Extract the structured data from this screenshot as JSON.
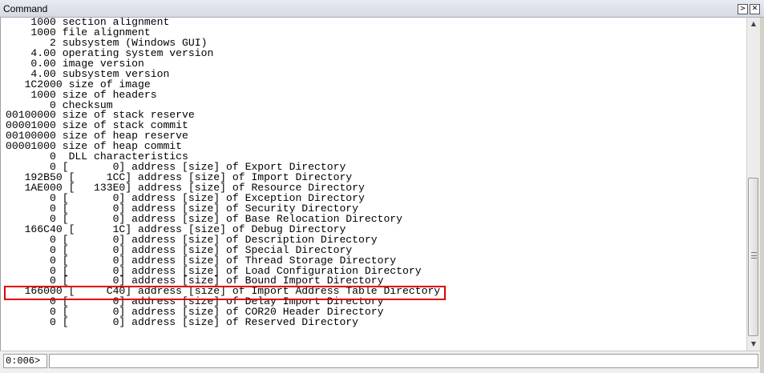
{
  "window": {
    "title": "Command",
    "command_icon": "command-window-icon",
    "close_icon": "close-icon"
  },
  "output": {
    "lines": [
      "    1000 section alignment",
      "    1000 file alignment",
      "       2 subsystem (Windows GUI)",
      "    4.00 operating system version",
      "    0.00 image version",
      "    4.00 subsystem version",
      "   1C2000 size of image",
      "    1000 size of headers",
      "       0 checksum",
      "00100000 size of stack reserve",
      "00001000 size of stack commit",
      "00100000 size of heap reserve",
      "00001000 size of heap commit",
      "       0  DLL characteristics",
      "       0 [       0] address [size] of Export Directory",
      "   192B50 [     1CC] address [size] of Import Directory",
      "   1AE000 [   133E0] address [size] of Resource Directory",
      "       0 [       0] address [size] of Exception Directory",
      "       0 [       0] address [size] of Security Directory",
      "       0 [       0] address [size] of Base Relocation Directory",
      "   166C40 [      1C] address [size] of Debug Directory",
      "       0 [       0] address [size] of Description Directory",
      "       0 [       0] address [size] of Special Directory",
      "       0 [       0] address [size] of Thread Storage Directory",
      "       0 [       0] address [size] of Load Configuration Directory",
      "       0 [       0] address [size] of Bound Import Directory",
      "   166000 [     C40] address [size] of Import Address Table Directory",
      "       0 [       0] address [size] of Delay Import Directory",
      "       0 [       0] address [size] of COR20 Header Directory",
      "       0 [       0] address [size] of Reserved Directory"
    ]
  },
  "scrollbar": {
    "up_icon": "scroll-up-arrow-icon",
    "down_icon": "scroll-down-arrow-icon",
    "position": 0.85
  },
  "command_bar": {
    "prompt": "0:006>",
    "input_value": "",
    "highlight_color": "#e00000"
  }
}
